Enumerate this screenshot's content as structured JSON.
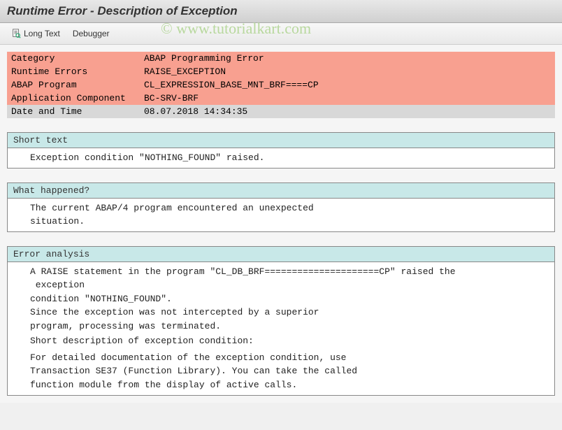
{
  "title": "Runtime Error - Description of Exception",
  "toolbar": {
    "long_text": "Long Text",
    "debugger": "Debugger"
  },
  "info": {
    "category_label": "Category",
    "category_value": "ABAP Programming Error",
    "runtime_errors_label": "Runtime Errors",
    "runtime_errors_value": "RAISE_EXCEPTION",
    "abap_program_label": "ABAP Program",
    "abap_program_value": "CL_EXPRESSION_BASE_MNT_BRF====CP",
    "app_component_label": "Application Component",
    "app_component_value": "BC-SRV-BRF",
    "date_time_label": "Date and Time",
    "date_time_value": "08.07.2018 14:34:35"
  },
  "sections": {
    "short_text": {
      "header": "Short text",
      "lines": [
        "Exception condition \"NOTHING_FOUND\" raised."
      ]
    },
    "what_happened": {
      "header": "What happened?",
      "lines": [
        "The current ABAP/4 program encountered an unexpected",
        "situation."
      ]
    },
    "error_analysis": {
      "header": "Error analysis",
      "lines": [
        "A RAISE statement in the program \"CL_DB_BRF=====================CP\" raised the",
        " exception",
        "condition \"NOTHING_FOUND\".",
        "Since the exception was not intercepted by a superior",
        "program, processing was terminated.",
        "",
        "Short description of exception condition:",
        "",
        "",
        "For detailed documentation of the exception condition, use",
        "Transaction SE37 (Function Library). You can take the called",
        "function module from the display of active calls."
      ]
    }
  },
  "watermark": "© www.tutorialkart.com"
}
